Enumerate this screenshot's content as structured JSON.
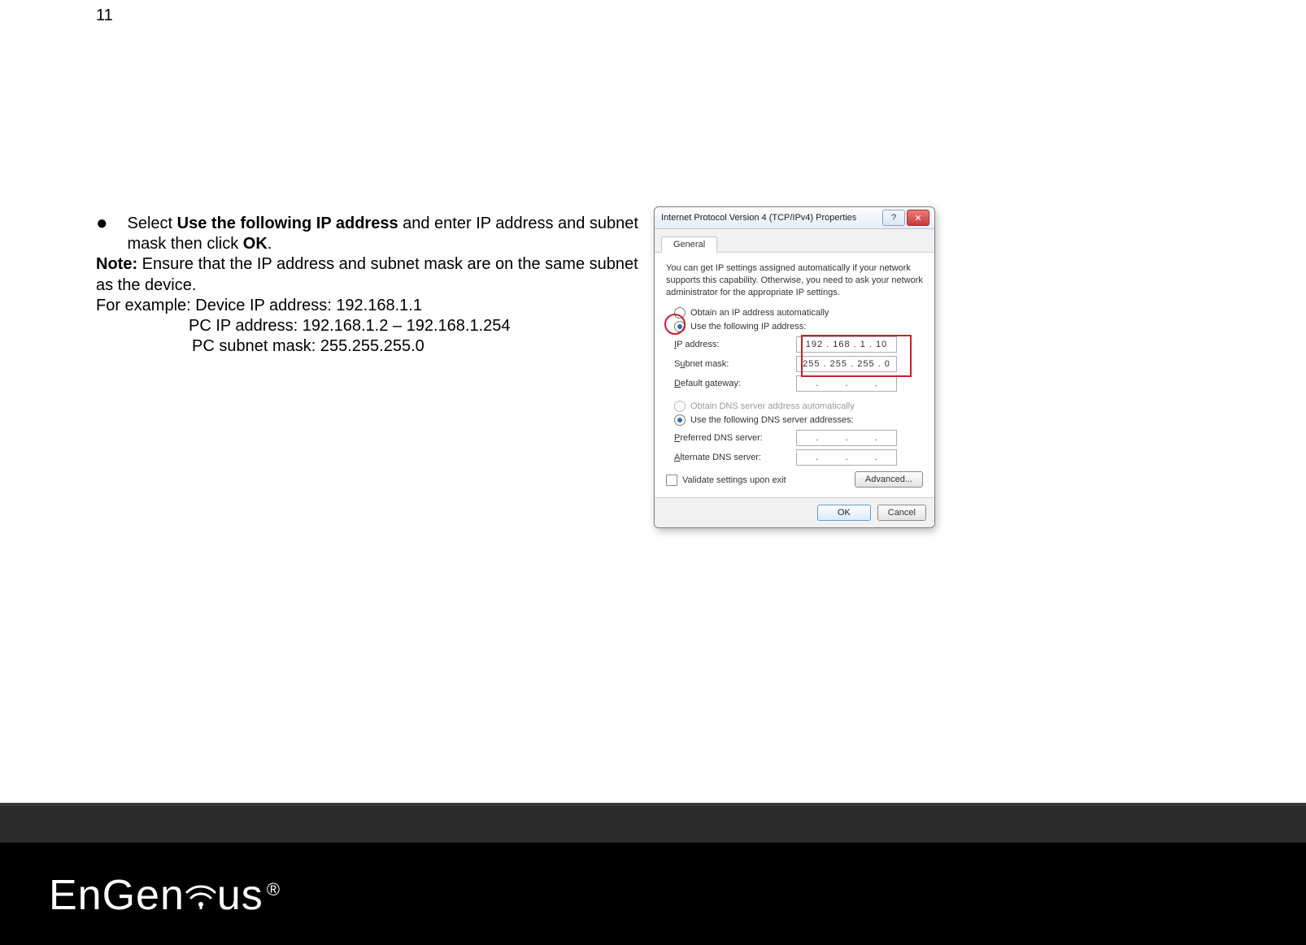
{
  "page_number": "11",
  "instructions": {
    "bullet_prefix": "Select ",
    "bullet_bold": "Use the following IP address",
    "bullet_mid": " and enter IP address and subnet mask then click ",
    "bullet_ok": "OK",
    "bullet_suffix": ".",
    "note_label": "Note:",
    "note_text": " Ensure that the IP address and subnet mask are on the same subnet as the device.",
    "example_line": "For example: Device IP address: 192.168.1.1",
    "pc_ip_line": "PC IP address: 192.168.1.2 – 192.168.1.254",
    "pc_mask_line": "PC subnet mask: 255.255.255.0"
  },
  "dialog": {
    "title": "Internet Protocol Version 4 (TCP/IPv4) Properties",
    "tab": "General",
    "intro": "You can get IP settings assigned automatically if your network supports this capability. Otherwise, you need to ask your network administrator for the appropriate IP settings.",
    "opt_auto_ip": "Obtain an IP address automatically",
    "opt_use_ip": "Use the following IP address:",
    "lbl_ip": "IP address:",
    "lbl_mask": "Subnet mask:",
    "lbl_gateway": "Default gateway:",
    "val_ip": "192 . 168 .   1    .   10",
    "val_mask": "255 . 255 . 255 .   0",
    "opt_auto_dns": "Obtain DNS server address automatically",
    "opt_use_dns": "Use the following DNS server addresses:",
    "lbl_pref_dns": "Preferred DNS server:",
    "lbl_alt_dns": "Alternate DNS server:",
    "validate": "Validate settings upon exit",
    "advanced": "Advanced...",
    "ok": "OK",
    "cancel": "Cancel",
    "help_glyph": "?",
    "close_glyph": "✕"
  },
  "brand": "EnGenius",
  "reg": "®"
}
